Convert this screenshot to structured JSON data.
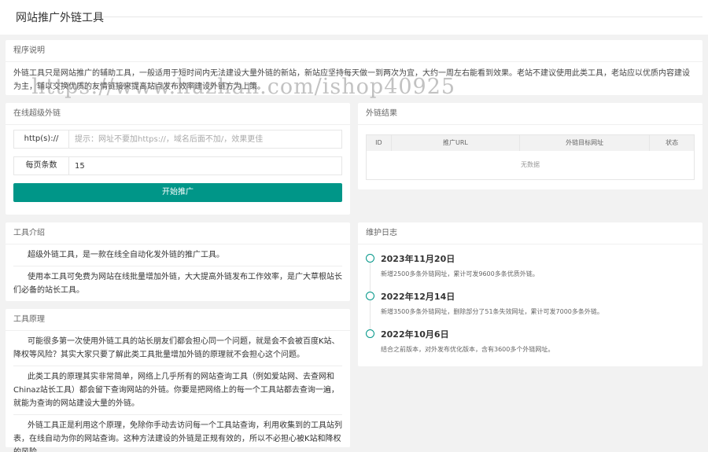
{
  "header": {
    "title": "网站推广外链工具"
  },
  "description": {
    "heading": "程序说明",
    "text": "外链工具只是网站推广的辅助工具，一般适用于短时间内无法建设大量外链的新站，新站应坚持每天做一到两次为宜，大约一周左右能看到效果。老站不建议使用此类工具，老站应以优质内容建设为主，辅以交换优质的友情链接来提高站点发布效率建设外链方为上策。",
    "watermark": "https://www.huzhan.com/ishop40925"
  },
  "form": {
    "heading": "在线超级外链",
    "url_label": "http(s)://",
    "url_placeholder": "提示：网址不要加https://，域名后面不加/，效果更佳",
    "per_page_label": "每页条数",
    "per_page_value": "15",
    "submit_label": "开始推广"
  },
  "result": {
    "heading": "外链结果",
    "columns": [
      "ID",
      "推广URL",
      "外链目标网址",
      "状态"
    ],
    "empty_text": "无数据"
  },
  "intro": {
    "heading": "工具介绍",
    "paragraphs": [
      "超级外链工具，是一款在线全自动化发外链的推广工具。",
      "使用本工具可免费为网站在线批量增加外链，大大提高外链发布工作效率，是广大草根站长们必备的站长工具。"
    ]
  },
  "principle": {
    "heading": "工具原理",
    "paragraphs": [
      "可能很多第一次使用外链工具的站长朋友们都会担心同一个问题，就是会不会被百度K站、降权等风险？其实大家只要了解此类工具批量增加外链的原理就不会担心这个问题。",
      "此类工具的原理其实非常简单，网络上几乎所有的网站查询工具（例如爱站网、去查网和Chinaz站长工具）都会留下查询网站的外链。你要是把网络上的每一个工具站都去查询一遍，就能为查询的网站建设大量的外链。",
      "外链工具正是利用这个原理，免除你手动去访问每一个工具站查询，利用收集到的工具站列表，在线自动为你的网站查询。这种方法建设的外链是正规有效的，所以不必担心被K站和降权的风险。"
    ]
  },
  "log": {
    "heading": "维护日志",
    "items": [
      {
        "date": "2023年11月20日",
        "text": "新增2500多条外链网址，累计可发9600多条优质外链。"
      },
      {
        "date": "2022年12月14日",
        "text": "新增3500多条外链网址，删除部分了51条失效网址，累计可发7000多条外链。"
      },
      {
        "date": "2022年10月6日",
        "text": "结合之前版本，对外发布优化版本，含有3600多个外链网址。"
      }
    ]
  },
  "colors": {
    "accent": "#009688",
    "background": "#f2f2f2"
  }
}
